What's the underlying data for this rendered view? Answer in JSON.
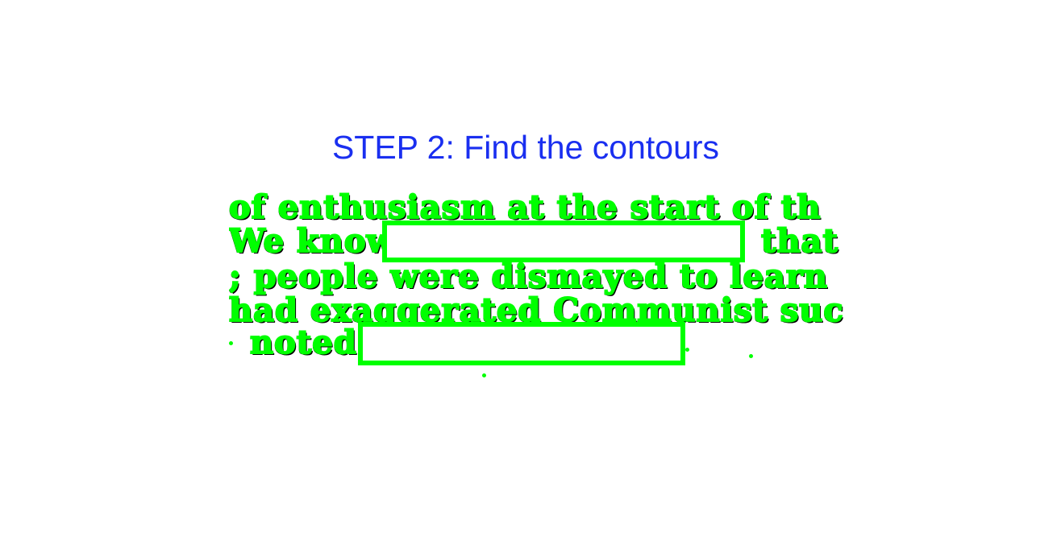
{
  "title": "STEP 2: Find the contours",
  "colors": {
    "title": "#1a2ff0",
    "contour": "#00ff00",
    "ink": "#000000",
    "background": "#ffffff"
  },
  "text_lines": [
    "of enthusiasm at the start of th",
    "We know",
    "that",
    "; people were dismayed to learn",
    "had exaggerated Communist succes",
    "noted"
  ],
  "redaction_boxes": [
    {
      "label": "redacted-region-1"
    },
    {
      "label": "redacted-region-2"
    }
  ]
}
